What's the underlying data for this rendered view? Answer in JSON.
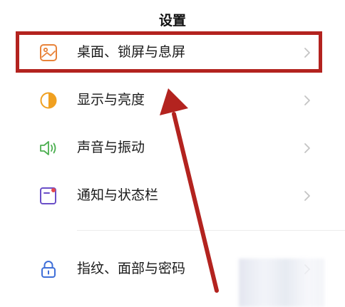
{
  "header": {
    "title": "设置"
  },
  "settings": {
    "items": [
      {
        "label": "桌面、锁屏与息屏",
        "icon": "wallpaper-icon"
      },
      {
        "label": "显示与亮度",
        "icon": "brightness-icon"
      },
      {
        "label": "声音与振动",
        "icon": "speaker-icon"
      },
      {
        "label": "通知与状态栏",
        "icon": "notification-icon"
      },
      {
        "label": "指纹、面部与密码",
        "icon": "lock-icon"
      }
    ]
  },
  "colors": {
    "annotation_red": "#b3231f",
    "wallpaper_icon": "#e8833a",
    "brightness_icon": "#f0a020",
    "speaker_icon": "#4caf50",
    "notification_icon": "#6a4fc8",
    "lock_icon": "#3f6fd8"
  }
}
